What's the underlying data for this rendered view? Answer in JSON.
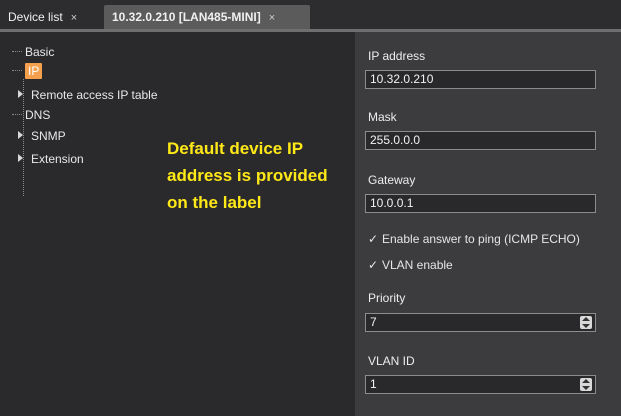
{
  "tabs": [
    {
      "label": "Device list",
      "close": "×"
    },
    {
      "label": "10.32.0.210 [LAN485-MINI]",
      "close": "×"
    }
  ],
  "tree": {
    "items": [
      {
        "label": "Basic",
        "expandable": false
      },
      {
        "label": "IP",
        "expandable": false,
        "selected": true
      },
      {
        "label": "Remote access IP table",
        "expandable": true
      },
      {
        "label": "DNS",
        "expandable": false
      },
      {
        "label": "SNMP",
        "expandable": true
      },
      {
        "label": "Extension",
        "expandable": true
      }
    ]
  },
  "annotation": {
    "text": "Default device IP address is provided on the label",
    "color": "#ffe817"
  },
  "form": {
    "ip_label": "IP address",
    "ip_value": "10.32.0.210",
    "mask_label": "Mask",
    "mask_value": "255.0.0.0",
    "gateway_label": "Gateway",
    "gateway_value": "10.0.0.1",
    "ping_label": "Enable answer to ping (ICMP ECHO)",
    "ping_checked": true,
    "vlan_label": "VLAN enable",
    "vlan_checked": true,
    "priority_label": "Priority",
    "priority_value": "7",
    "vlan_id_label": "VLAN ID",
    "vlan_id_value": "1"
  },
  "colors": {
    "selection": "#f5a04c",
    "active_tab": "#5b5b5b"
  }
}
